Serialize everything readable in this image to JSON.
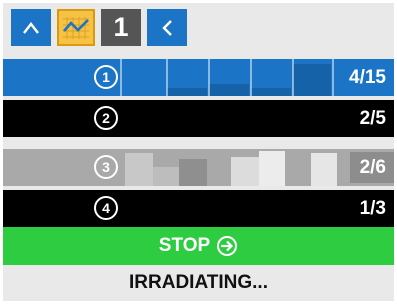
{
  "toolbar": {
    "home_icon": "chevron-up-icon",
    "chart_icon": "line-chart-icon",
    "selected_number": "1",
    "back_icon": "chevron-left-icon"
  },
  "rows": [
    {
      "number": "1",
      "count": "4/15",
      "color": "#1b74c6"
    },
    {
      "number": "2",
      "count": "2/5",
      "color": "#000000"
    },
    {
      "number": "3",
      "count": "2/6",
      "color": "#a9a9a9"
    },
    {
      "number": "4",
      "count": "1/3",
      "color": "#000000"
    }
  ],
  "stop_button": {
    "label": "STOP",
    "icon": "arrow-right-circle-icon",
    "color": "#2ecc40"
  },
  "status": {
    "text": "IRRADIATING..."
  }
}
